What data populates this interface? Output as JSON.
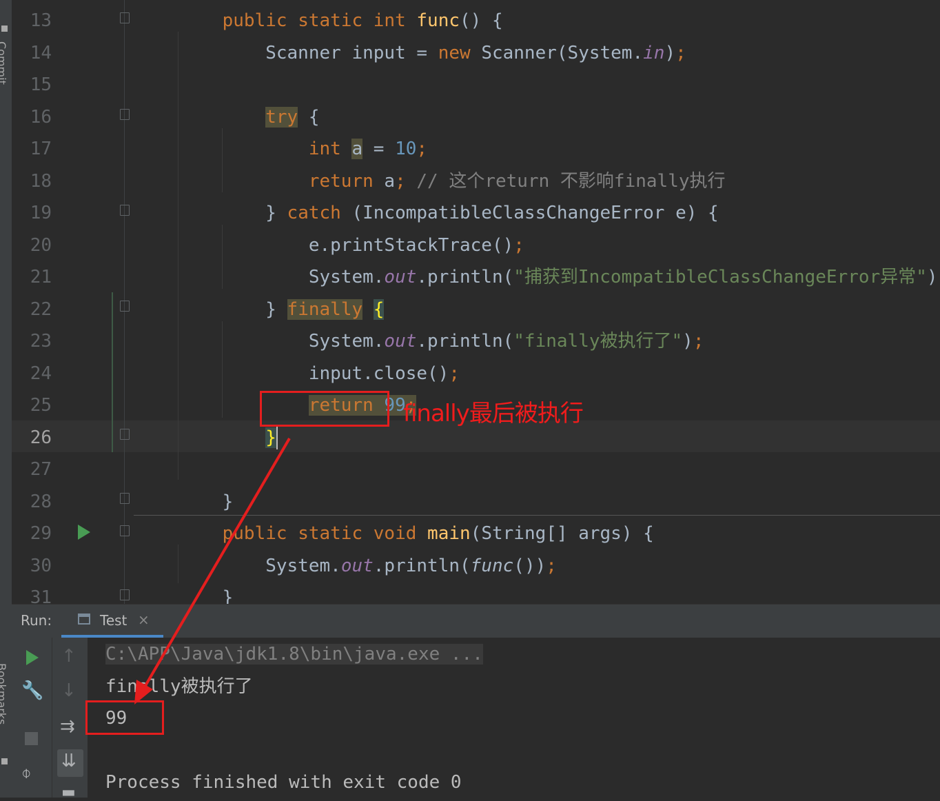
{
  "left_strip": {
    "top_label": "Commit",
    "bottom_label": "Bookmarks"
  },
  "editor": {
    "lines": [
      {
        "n": "13",
        "segs": [
          [
            "",
            "    "
          ],
          [
            "kw",
            "public static int "
          ],
          [
            "fn",
            "func"
          ],
          [
            "",
            "() {"
          ]
        ]
      },
      {
        "n": "14",
        "segs": [
          [
            "",
            "        Scanner input = "
          ],
          [
            "kw",
            "new "
          ],
          [
            "",
            "Scanner(System."
          ],
          [
            "fld",
            "in"
          ],
          [
            "",
            ")"
          ],
          [
            "kw",
            ";"
          ]
        ]
      },
      {
        "n": "15",
        "segs": [
          [
            "",
            ""
          ]
        ]
      },
      {
        "n": "16",
        "segs": [
          [
            "",
            "        "
          ],
          [
            "kw hl",
            "try"
          ],
          [
            "",
            " {"
          ]
        ]
      },
      {
        "n": "17",
        "segs": [
          [
            "",
            "            "
          ],
          [
            "kw",
            "int "
          ],
          [
            "hl",
            "a"
          ],
          [
            "",
            " = "
          ],
          [
            "num",
            "10"
          ],
          [
            "kw",
            ";"
          ]
        ]
      },
      {
        "n": "18",
        "segs": [
          [
            "",
            "            "
          ],
          [
            "kw",
            "return "
          ],
          [
            "",
            "a"
          ],
          [
            "kw",
            "; "
          ],
          [
            "cmt",
            "// 这个return 不影响finally执行"
          ]
        ]
      },
      {
        "n": "19",
        "segs": [
          [
            "",
            "        } "
          ],
          [
            "kw",
            "catch "
          ],
          [
            "",
            "(IncompatibleClassChangeError e) {"
          ]
        ]
      },
      {
        "n": "20",
        "segs": [
          [
            "",
            "            e.printStackTrace()"
          ],
          [
            "kw",
            ";"
          ]
        ]
      },
      {
        "n": "21",
        "segs": [
          [
            "",
            "            System."
          ],
          [
            "fld",
            "out"
          ],
          [
            "",
            ".println("
          ],
          [
            "str",
            "\"捕获到IncompatibleClassChangeError异常\""
          ],
          [
            "",
            ")"
          ],
          [
            "kw",
            ";"
          ]
        ]
      },
      {
        "n": "22",
        "segs": [
          [
            "",
            "        } "
          ],
          [
            "kw hl",
            "finally"
          ],
          [
            "",
            " "
          ],
          [
            "hlp",
            "{"
          ]
        ]
      },
      {
        "n": "23",
        "segs": [
          [
            "",
            "            System."
          ],
          [
            "fld",
            "out"
          ],
          [
            "",
            ".println("
          ],
          [
            "str",
            "\"finally被执行了\""
          ],
          [
            "",
            ")"
          ],
          [
            "kw",
            ";"
          ]
        ]
      },
      {
        "n": "24",
        "segs": [
          [
            "",
            "            input.close()"
          ],
          [
            "kw",
            ";"
          ]
        ]
      },
      {
        "n": "25",
        "segs": [
          [
            "",
            "            "
          ],
          [
            "kw hl",
            "return "
          ],
          [
            "num hl",
            "99"
          ],
          [
            "kw hl",
            ";"
          ]
        ]
      },
      {
        "n": "26",
        "segs": [
          [
            "",
            "        "
          ],
          [
            "hlp",
            "}"
          ],
          [
            "caret",
            ""
          ]
        ]
      },
      {
        "n": "27",
        "segs": [
          [
            "",
            ""
          ]
        ]
      },
      {
        "n": "28",
        "segs": [
          [
            "",
            "    }"
          ]
        ]
      },
      {
        "n": "29",
        "segs": [
          [
            "",
            "    "
          ],
          [
            "kw",
            "public static void "
          ],
          [
            "fn",
            "main"
          ],
          [
            "",
            "(String[] args) {"
          ]
        ]
      },
      {
        "n": "30",
        "segs": [
          [
            "",
            "        System."
          ],
          [
            "fld",
            "out"
          ],
          [
            "",
            ".println("
          ],
          [
            "ital",
            "func"
          ],
          [
            "",
            "())"
          ],
          [
            "kw",
            ";"
          ]
        ]
      },
      {
        "n": "31",
        "segs": [
          [
            "",
            "    }"
          ]
        ]
      }
    ],
    "current_line": "26"
  },
  "annotation": {
    "text": "finally最后被执行",
    "color": "#f01c1c"
  },
  "run_panel": {
    "label": "Run:",
    "tab_label": "Test",
    "tab_close": "×",
    "console": {
      "command": "C:\\APP\\Java\\jdk1.8\\bin\\java.exe ...",
      "output_lines": [
        "finally被执行了",
        "99",
        "",
        "Process finished with exit code 0"
      ]
    }
  },
  "colors": {
    "keyword": "#cc7832",
    "function": "#ffc66d",
    "number": "#6897bb",
    "string": "#6a8759",
    "field": "#9876aa",
    "run_green": "#499c54"
  }
}
